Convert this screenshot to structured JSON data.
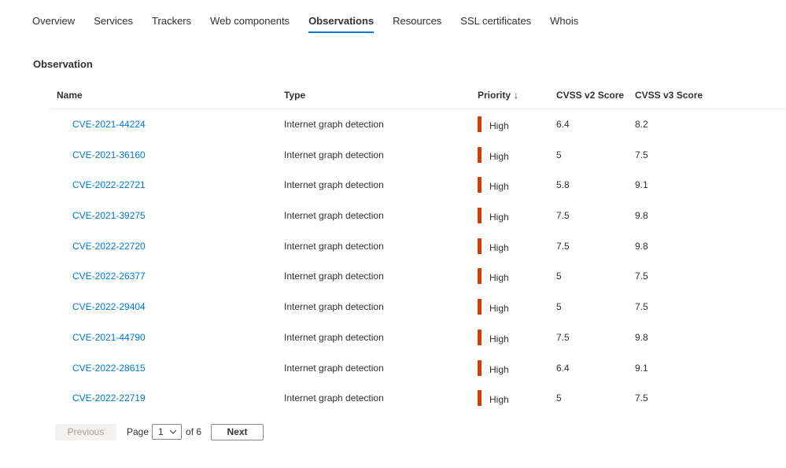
{
  "tabs": [
    {
      "label": "Overview",
      "active": false
    },
    {
      "label": "Services",
      "active": false
    },
    {
      "label": "Trackers",
      "active": false
    },
    {
      "label": "Web components",
      "active": false
    },
    {
      "label": "Observations",
      "active": true
    },
    {
      "label": "Resources",
      "active": false
    },
    {
      "label": "SSL certificates",
      "active": false
    },
    {
      "label": "Whois",
      "active": false
    }
  ],
  "section": {
    "title": "Observation"
  },
  "table": {
    "columns": {
      "name": "Name",
      "type": "Type",
      "priority": "Priority",
      "priority_sort_icon": "↓",
      "cvss2": "CVSS v2 Score",
      "cvss3": "CVSS v3 Score"
    },
    "rows": [
      {
        "name": "CVE-2021-44224",
        "type": "Internet graph detection",
        "priority": "High",
        "cvss2": "6.4",
        "cvss3": "8.2"
      },
      {
        "name": "CVE-2021-36160",
        "type": "Internet graph detection",
        "priority": "High",
        "cvss2": "5",
        "cvss3": "7.5"
      },
      {
        "name": "CVE-2022-22721",
        "type": "Internet graph detection",
        "priority": "High",
        "cvss2": "5.8",
        "cvss3": "9.1"
      },
      {
        "name": "CVE-2021-39275",
        "type": "Internet graph detection",
        "priority": "High",
        "cvss2": "7.5",
        "cvss3": "9.8"
      },
      {
        "name": "CVE-2022-22720",
        "type": "Internet graph detection",
        "priority": "High",
        "cvss2": "7.5",
        "cvss3": "9.8"
      },
      {
        "name": "CVE-2022-26377",
        "type": "Internet graph detection",
        "priority": "High",
        "cvss2": "5",
        "cvss3": "7.5"
      },
      {
        "name": "CVE-2022-29404",
        "type": "Internet graph detection",
        "priority": "High",
        "cvss2": "5",
        "cvss3": "7.5"
      },
      {
        "name": "CVE-2021-44790",
        "type": "Internet graph detection",
        "priority": "High",
        "cvss2": "7.5",
        "cvss3": "9.8"
      },
      {
        "name": "CVE-2022-28615",
        "type": "Internet graph detection",
        "priority": "High",
        "cvss2": "6.4",
        "cvss3": "9.1"
      },
      {
        "name": "CVE-2022-22719",
        "type": "Internet graph detection",
        "priority": "High",
        "cvss2": "5",
        "cvss3": "7.5"
      }
    ]
  },
  "pager": {
    "previous_label": "Previous",
    "page_label": "Page",
    "current_page": "1",
    "of_label": "of 6",
    "next_label": "Next"
  },
  "colors": {
    "link": "#0078d4",
    "active_tab_underline": "#0078d4",
    "priority_high": "#d83b01"
  }
}
